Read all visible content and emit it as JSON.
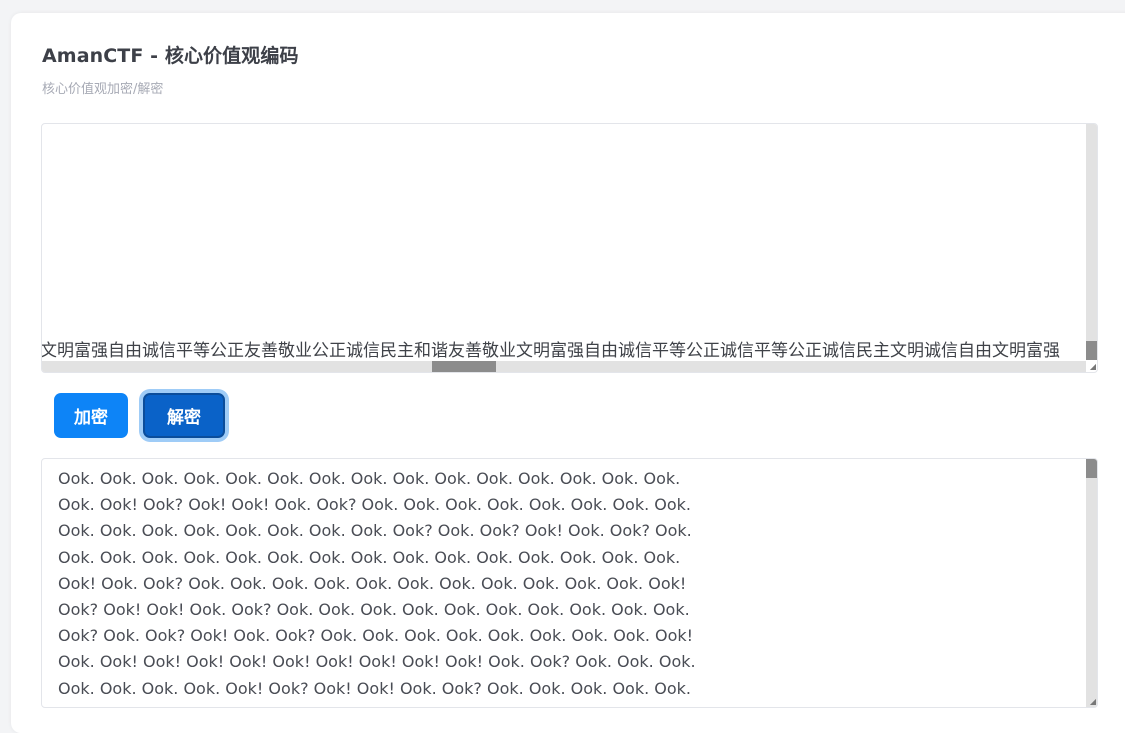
{
  "header": {
    "title": "AmanCTF - 核心价值观编码",
    "subtitle": "核心价值观加密/解密"
  },
  "input_area": {
    "value": "文明富强自由诚信平等公正友善敬业公正诚信民主和谐友善敬业文明富强自由诚信平等公正诚信平等公正诚信民主文明诚信自由文明富强"
  },
  "buttons": {
    "encrypt_label": "加密",
    "decrypt_label": "解密"
  },
  "output_area": {
    "lines": [
      "Ook. Ook. Ook. Ook. Ook. Ook. Ook. Ook. Ook. Ook. Ook. Ook. Ook. Ook. Ook.",
      "Ook. Ook! Ook? Ook! Ook! Ook. Ook? Ook. Ook. Ook. Ook. Ook. Ook. Ook. Ook.",
      "Ook. Ook. Ook. Ook. Ook. Ook. Ook. Ook. Ook? Ook. Ook? Ook! Ook. Ook? Ook.",
      "Ook. Ook. Ook. Ook. Ook. Ook. Ook. Ook. Ook. Ook. Ook. Ook. Ook. Ook. Ook.",
      "Ook! Ook. Ook? Ook. Ook. Ook. Ook. Ook. Ook. Ook. Ook. Ook. Ook. Ook. Ook!",
      "Ook? Ook! Ook! Ook. Ook? Ook. Ook. Ook. Ook. Ook. Ook. Ook. Ook. Ook. Ook.",
      "Ook? Ook. Ook? Ook! Ook. Ook? Ook. Ook. Ook. Ook. Ook. Ook. Ook. Ook. Ook!",
      "Ook. Ook! Ook! Ook! Ook! Ook! Ook! Ook! Ook! Ook! Ook. Ook? Ook. Ook. Ook.",
      "Ook. Ook. Ook. Ook. Ook! Ook? Ook! Ook! Ook. Ook? Ook. Ook. Ook. Ook. Ook."
    ]
  }
}
